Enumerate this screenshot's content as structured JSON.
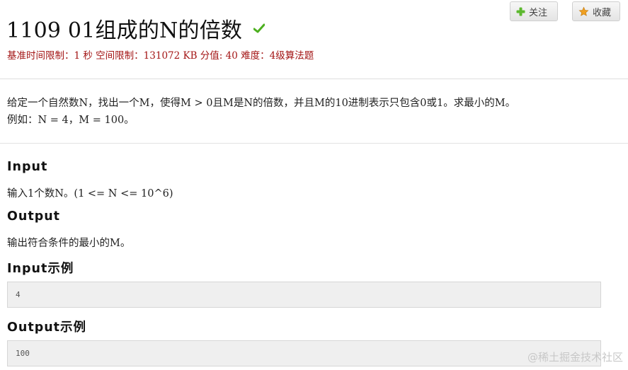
{
  "problem": {
    "title": "1109 01组成的N的倍数",
    "limits": "基准时间限制：1 秒 空间限制：131072 KB 分值: 40 难度：4级算法题"
  },
  "actions": {
    "follow_label": "关注",
    "favorite_label": "收藏"
  },
  "description": {
    "line1": "给定一个自然数N，找出一个M，使得M > 0且M是N的倍数，并且M的10进制表示只包含0或1。求最小的M。",
    "line2": "例如：N = 4，M = 100。"
  },
  "input": {
    "heading": "Input",
    "text": "输入1个数N。(1 <= N <= 10^6)"
  },
  "output": {
    "heading": "Output",
    "text": "输出符合条件的最小的M。"
  },
  "input_example": {
    "heading": "Input示例",
    "value": "4"
  },
  "output_example": {
    "heading": "Output示例",
    "value": "100"
  },
  "watermark": "@稀土掘金技术社区",
  "colors": {
    "limits": "#a31515",
    "check": "#4caf1f",
    "follow_plus": "#5cb82e",
    "favorite_star": "#f0a020"
  }
}
